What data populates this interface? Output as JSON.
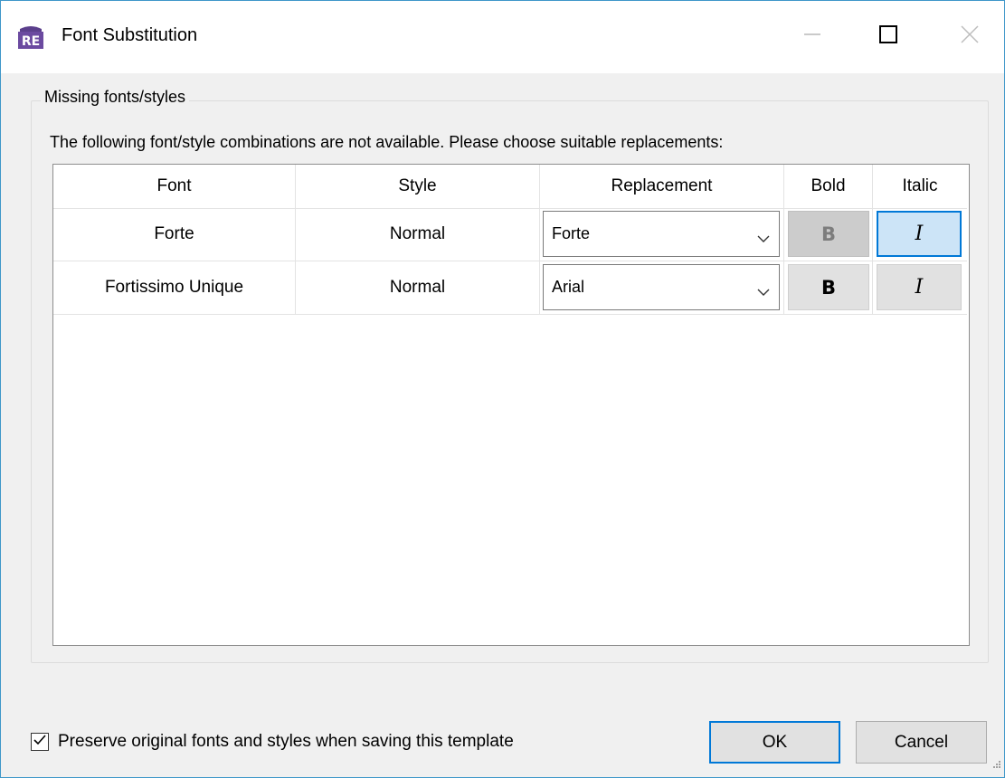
{
  "window": {
    "title": "Font Substitution",
    "app_icon_text": "RE",
    "accent": "#0078d7"
  },
  "group": {
    "label": "Missing fonts/styles",
    "instructions": "The following font/style combinations are not available. Please choose suitable replacements:"
  },
  "table": {
    "headers": {
      "font": "Font",
      "style": "Style",
      "replacement": "Replacement",
      "bold": "Bold",
      "italic": "Italic"
    },
    "rows": [
      {
        "font": "Forte",
        "style": "Normal",
        "replacement": "Forte",
        "bold_label": "B",
        "italic_label": "I",
        "bold_state": "disabled",
        "italic_state": "checked"
      },
      {
        "font": "Fortissimo Unique",
        "style": "Normal",
        "replacement": "Arial",
        "bold_label": "B",
        "italic_label": "I",
        "bold_state": "normal",
        "italic_state": "normal"
      }
    ]
  },
  "options": {
    "preserve_label": "Preserve original fonts and styles when saving this template",
    "preserve_checked": true
  },
  "buttons": {
    "ok": "OK",
    "cancel": "Cancel"
  },
  "icons": {
    "app": "re-app-icon",
    "minimize": "minimize-icon",
    "maximize": "maximize-icon",
    "close": "close-icon",
    "dropdown": "chevron-down-icon",
    "check": "checkmark-icon",
    "resize": "resize-grip-icon"
  }
}
